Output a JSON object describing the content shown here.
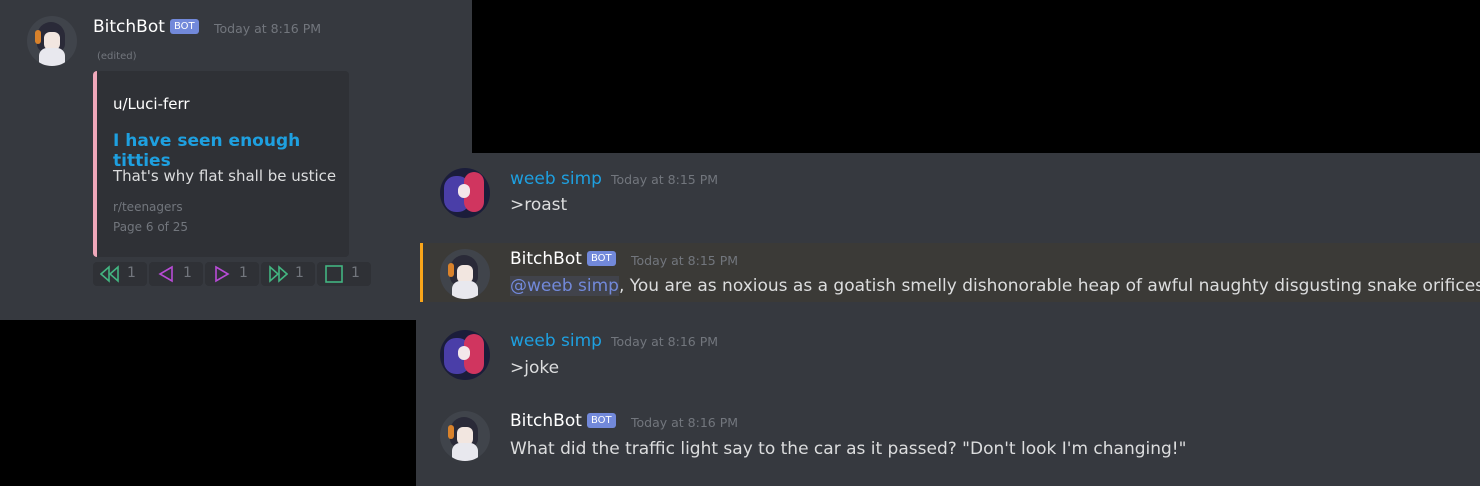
{
  "left_message": {
    "author": "BitchBot",
    "bot_tag": "BOT",
    "timestamp": "Today at 8:16 PM",
    "edited": "(edited)",
    "embed": {
      "author": "u/Luci-ferr",
      "title": "I have seen enough titties",
      "description": "That's why flat shall be ustice",
      "footer_sub": "r/teenagers",
      "footer_page": "Page 6 of 25",
      "accent_color": "#f0a8ba"
    },
    "reactions": [
      {
        "icon": "double-left-arrow-icon",
        "count": "1",
        "color": "#43b581"
      },
      {
        "icon": "left-arrow-icon",
        "count": "1",
        "color": "#b84bd6"
      },
      {
        "icon": "right-arrow-icon",
        "count": "1",
        "color": "#b84bd6"
      },
      {
        "icon": "double-right-arrow-icon",
        "count": "1",
        "color": "#43b581"
      },
      {
        "icon": "stop-square-icon",
        "count": "1",
        "color": "#43b581"
      }
    ]
  },
  "right_messages": [
    {
      "author": "weeb simp",
      "timestamp": "Today at 8:15 PM",
      "text": ">roast"
    },
    {
      "author": "BitchBot",
      "bot_tag": "BOT",
      "timestamp": "Today at 8:15 PM",
      "mention": "@weeb simp",
      "text": ", You are as noxious as a goatish smelly dishonorable heap of awful naughty disgusting snake orifices"
    },
    {
      "author": "weeb simp",
      "timestamp": "Today at 8:16 PM",
      "text": ">joke"
    },
    {
      "author": "BitchBot",
      "bot_tag": "BOT",
      "timestamp": "Today at 8:16 PM",
      "text": "What did the traffic light say to the car as it passed? \"Don't look I'm changing!\""
    }
  ],
  "colors": {
    "background": "#36393f",
    "mention_highlight": "#faa61a",
    "weeb_name": "#1ea0e0",
    "bot_tag": "#7289da"
  }
}
